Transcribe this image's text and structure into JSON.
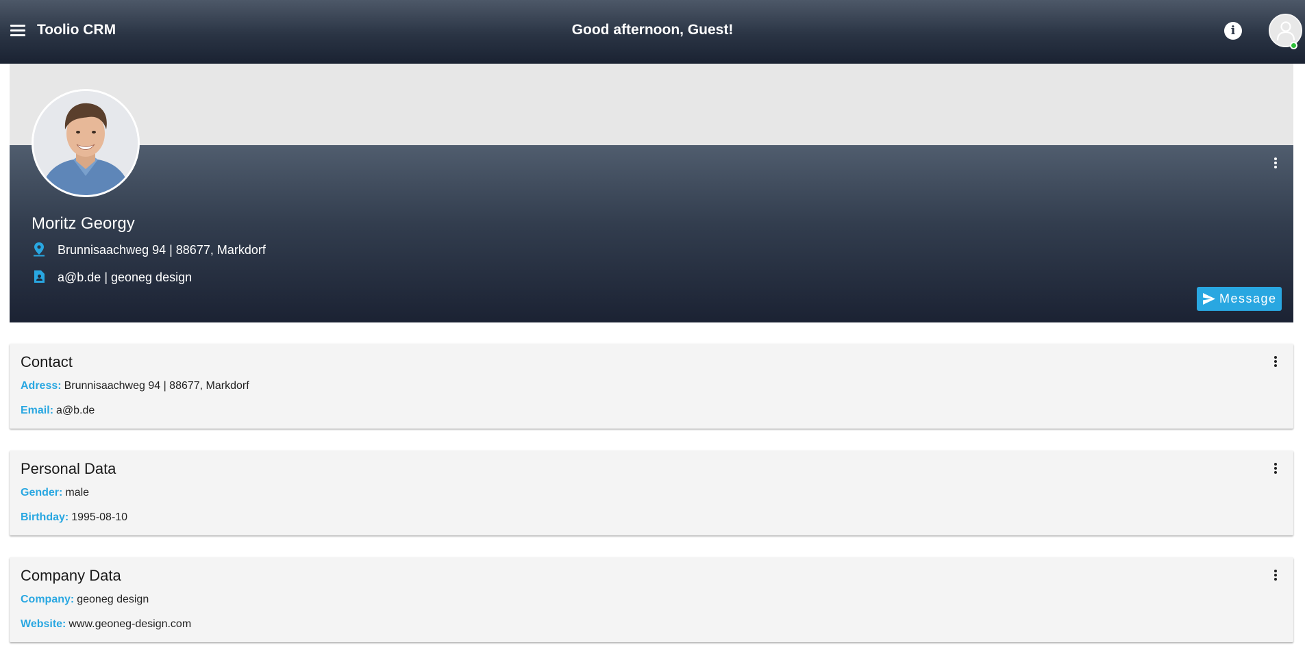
{
  "app": {
    "title": "Toolio CRM"
  },
  "header": {
    "greeting": "Good afternoon, Guest!"
  },
  "profile": {
    "name": "Moritz Georgy",
    "address": "Brunnisaachweg 94 | 88677, Markdorf",
    "contact": "a@b.de | geoneg design",
    "message_label": "Message"
  },
  "sections": {
    "contact": {
      "title": "Contact",
      "rows": [
        {
          "label": "Adress:",
          "value": "Brunnisaachweg 94 | 88677, Markdorf"
        },
        {
          "label": "Email:",
          "value": "a@b.de"
        }
      ]
    },
    "personal": {
      "title": "Personal Data",
      "rows": [
        {
          "label": "Gender:",
          "value": "male"
        },
        {
          "label": "Birthday:",
          "value": "1995-08-10"
        }
      ]
    },
    "company": {
      "title": "Company Data",
      "rows": [
        {
          "label": "Company:",
          "value": "geoneg design"
        },
        {
          "label": "Website:",
          "value": "www.geoneg-design.com"
        }
      ]
    }
  },
  "icons": {
    "menu": "menu-icon",
    "info": "info-icon",
    "user": "user-avatar-icon",
    "location": "location-pin-icon",
    "contact_card": "contact-card-icon",
    "send": "send-icon",
    "more": "more-vert-icon"
  },
  "colors": {
    "accent": "#29a7e1",
    "header_top": "#4d5868",
    "header_bottom": "#1a2232",
    "online": "#2fbf3a",
    "card_bg": "#f4f4f4"
  }
}
